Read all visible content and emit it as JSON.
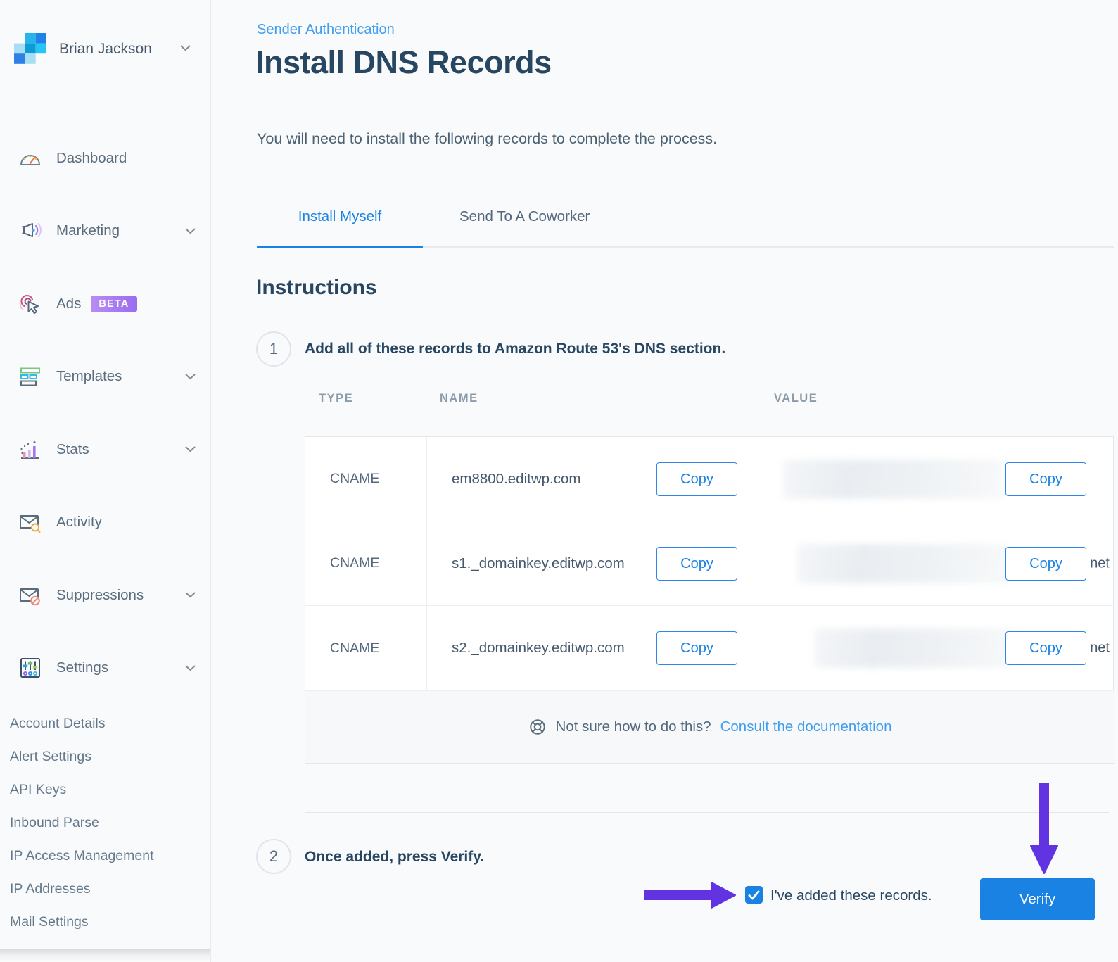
{
  "colors": {
    "accent_blue": "#1a82e2",
    "link_blue": "#3f9eef",
    "heading_navy": "#274661",
    "muted_text": "#54687d",
    "annotation_purple": "#6233e0",
    "beta_badge_gradient": [
      "#bb8cf3",
      "#9a6cf0"
    ]
  },
  "sidebar": {
    "user": {
      "name": "Brian Jackson"
    },
    "items": [
      {
        "label": "Dashboard"
      },
      {
        "label": "Marketing"
      },
      {
        "label": "Ads",
        "badge": "BETA"
      },
      {
        "label": "Templates"
      },
      {
        "label": "Stats"
      },
      {
        "label": "Activity"
      },
      {
        "label": "Suppressions"
      },
      {
        "label": "Settings"
      }
    ],
    "settings_subitems": [
      {
        "label": "Account Details"
      },
      {
        "label": "Alert Settings"
      },
      {
        "label": "API Keys"
      },
      {
        "label": "Inbound Parse"
      },
      {
        "label": "IP Access Management"
      },
      {
        "label": "IP Addresses"
      },
      {
        "label": "Mail Settings"
      }
    ]
  },
  "main": {
    "breadcrumb": "Sender Authentication",
    "title": "Install DNS Records",
    "intro": "You will need to install the following records to complete the process.",
    "tabs": [
      {
        "label": "Install Myself"
      },
      {
        "label": "Send To A Coworker"
      }
    ],
    "section_title": "Instructions",
    "step1": {
      "number": "1",
      "text": "Add all of these records to Amazon Route 53's DNS section."
    },
    "step2": {
      "number": "2",
      "text": "Once added, press Verify."
    },
    "table": {
      "headers": {
        "type": "TYPE",
        "name": "NAME",
        "value": "VALUE"
      },
      "rows": [
        {
          "type": "CNAME",
          "name": "em8800.editwp.com",
          "name_copy": "Copy",
          "value_copy": "Copy",
          "value_tail": ""
        },
        {
          "type": "CNAME",
          "name": "s1._domainkey.editwp.com",
          "name_copy": "Copy",
          "value_copy": "Copy",
          "value_tail": "net"
        },
        {
          "type": "CNAME",
          "name": "s2._domainkey.editwp.com",
          "name_copy": "Copy",
          "value_copy": "Copy",
          "value_tail": "net"
        }
      ],
      "footer": {
        "question": "Not sure how to do this?",
        "link": "Consult the documentation"
      }
    },
    "verify": {
      "checkbox_label": "I've added these records.",
      "checked": true,
      "button_label": "Verify"
    }
  }
}
